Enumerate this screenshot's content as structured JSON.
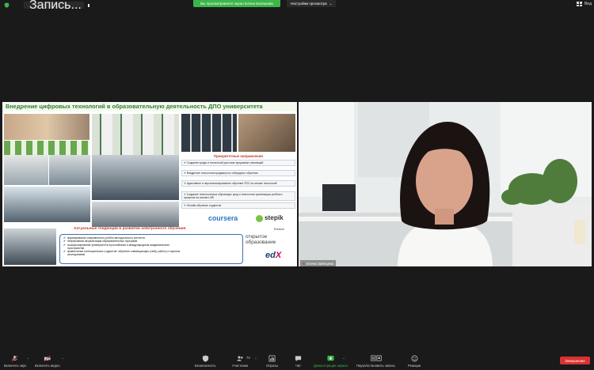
{
  "topbar": {
    "recording_label": "Запись...",
    "share_banner": "Вы просматриваете экран Елена Балашова",
    "view_options": "Настройки просмотра",
    "view_button": "Вид"
  },
  "slide": {
    "title": "Внедрение цифровых технологий в образовательную деятельность ДПО университета",
    "priorities_title": "Приоритетные направления",
    "priorities": [
      {
        "lead": "Создание среды и технологий для зоны прорывных",
        "rest": "инноваций"
      },
      {
        "lead": "Внедрение технологии продвинутого гибридного",
        "rest": "обучения"
      },
      {
        "lead": "Адаптивное и персонализированное обучение ППС на",
        "rest": "основе технологий"
      },
      {
        "lead": "Создание технологичных обучающих сред и технологии",
        "rest": "организации учебного процесса на основе LMS"
      },
      {
        "lead": "Онлайн-обучение студентов",
        "rest": ""
      }
    ],
    "logos": {
      "coursera": "coursera",
      "stepik": "stepik",
      "eduson": "Eduson",
      "openedu_line1": "открытое",
      "openedu_line2": "образование",
      "edx_ed": "ed",
      "edx_x": "X"
    },
    "trends_title": "Актуальные тенденции в развитии электронного обучения",
    "trends": [
      "формирование современного учебно-методического контента",
      "непрерывная актуализация образовательных программ",
      "позиционирование университета в российском и международном академическом",
      "пространстве",
      "привлечение потенциальных студентов: обучение совмещающих учебу, работу и научные",
      "исследования"
    ]
  },
  "video": {
    "participant_name": "Елена Зайнцева"
  },
  "toolbar": {
    "mute": "Включить звук",
    "video": "Включить видео",
    "security": "Безопасность",
    "participants": "Участники",
    "participants_count": "74",
    "polls": "Опросы",
    "chat": "Чат",
    "share_screen": "Демонстрация экрана",
    "pause_recording": "Пауза/остановить запись",
    "reactions": "Реакции",
    "end": "Завершение"
  },
  "colors": {
    "share_banner": "#3cb54a",
    "end_button": "#d9322f",
    "slide_title": "#2e7d32",
    "accent_red": "#c0392b"
  }
}
